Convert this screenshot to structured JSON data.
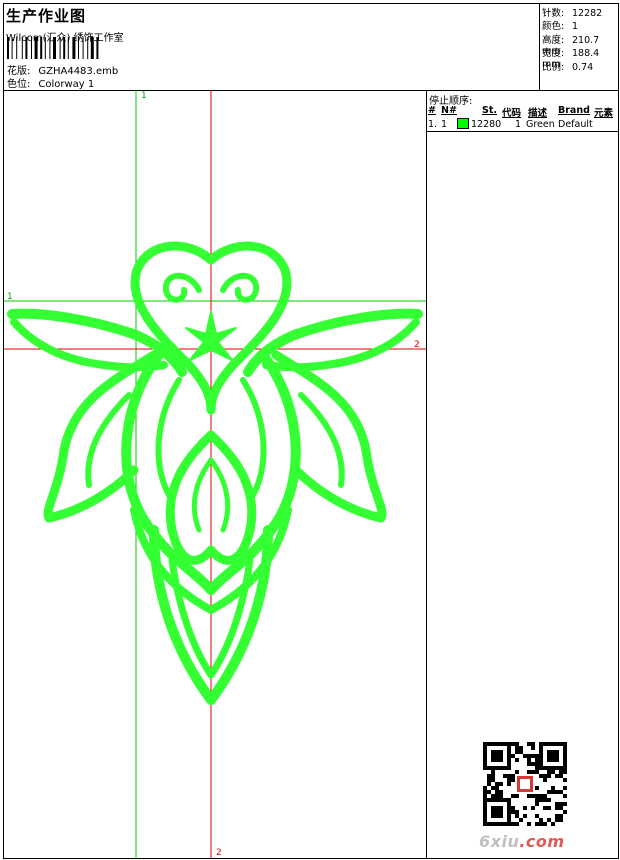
{
  "header": {
    "title": "生产作业图",
    "studio": "Wilcom(汇众) 绣饰工作室",
    "design_label": "花版:",
    "design_file": "GZHA4483.emb",
    "colorway_label": "色位:",
    "colorway": "Colorway 1"
  },
  "stats": [
    {
      "label": "针数:",
      "value": "12282"
    },
    {
      "label": "颜色:",
      "value": "1"
    },
    {
      "label": "高度:",
      "value": "210.7 mm"
    },
    {
      "label": "宽度:",
      "value": "188.4 mm"
    },
    {
      "label": "比例:",
      "value": "0.74"
    }
  ],
  "canvas": {
    "green_marker_label": "1",
    "red_marker_label": "2",
    "stitch_color": "#33ff33",
    "guide_green": "#00cc00",
    "guide_red": "#e00000"
  },
  "stop_order": {
    "title": "停止顺序:",
    "columns": [
      "#",
      "N#",
      "St.",
      "代码",
      "描述",
      "Brand",
      "元素"
    ],
    "rows": [
      {
        "index": "1.",
        "n": "1",
        "color": "#00ff00",
        "stitches": "12280",
        "code": "1",
        "desc": "Green",
        "brand": "Default",
        "element": ""
      }
    ]
  },
  "watermark": {
    "prefix": "6xiu",
    "suffix": ".com"
  }
}
